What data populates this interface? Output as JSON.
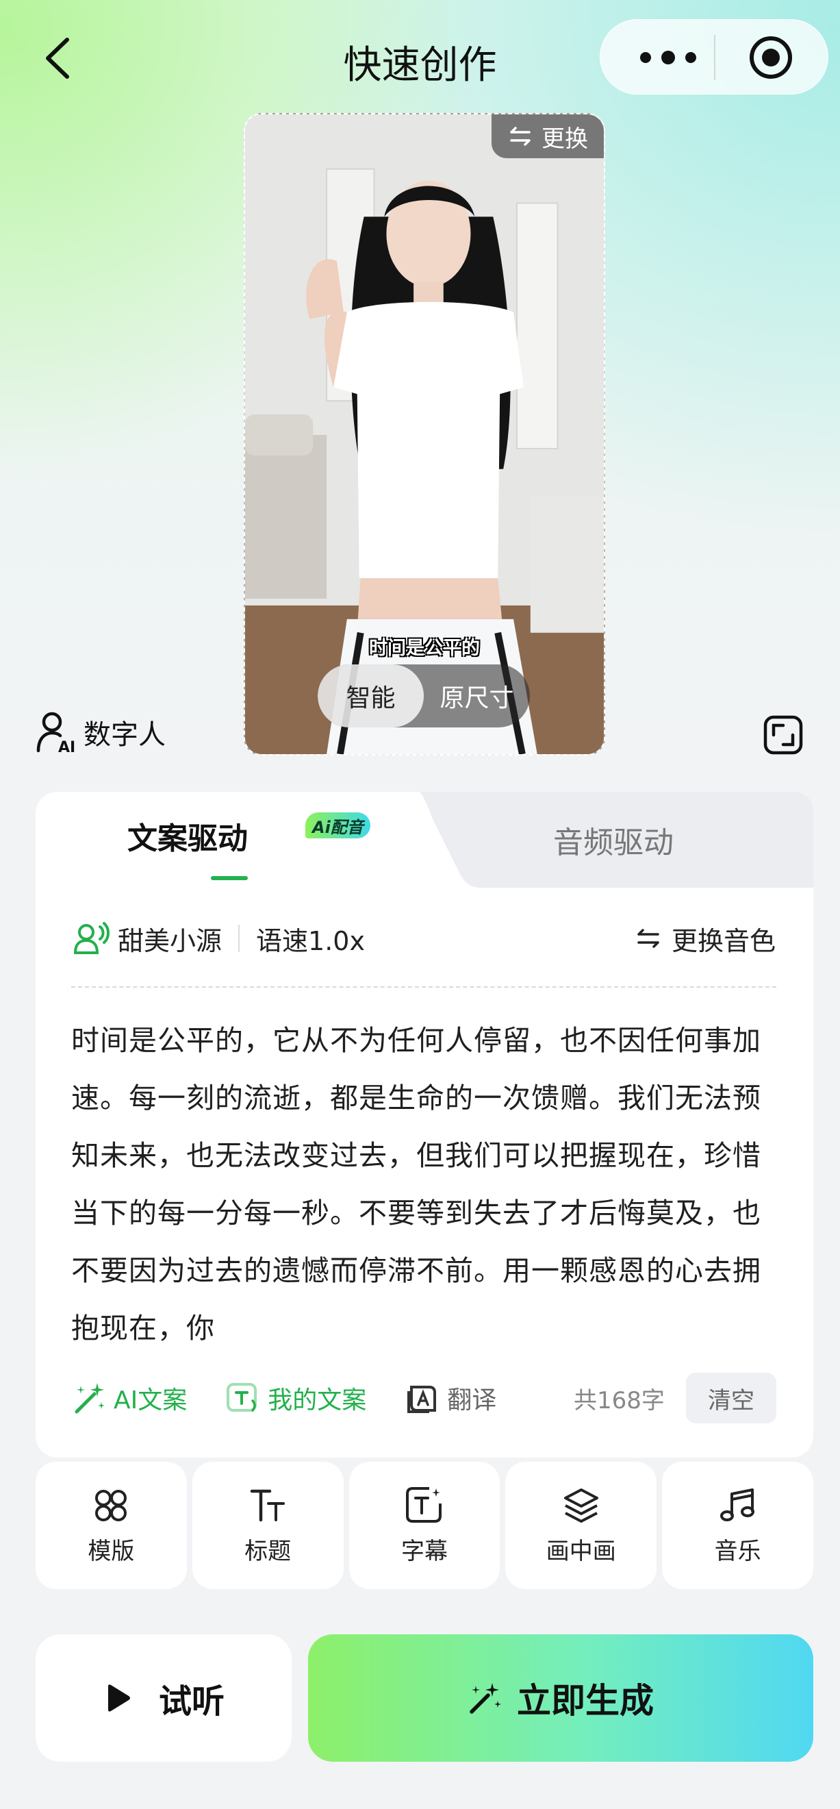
{
  "nav": {
    "title": "快速创作"
  },
  "preview": {
    "change_label": "更换",
    "subtitle": "时间是公平的",
    "size_options": [
      "智能",
      "原尺寸"
    ],
    "active_size": "智能"
  },
  "digital_human": {
    "label": "数字人"
  },
  "tabs": {
    "text_drive": "文案驱动",
    "ai_badge": "Ai配音",
    "audio_drive": "音频驱动"
  },
  "voice": {
    "name": "甜美小源",
    "speed": "语速1.0x",
    "change_label": "更换音色"
  },
  "script_text": "时间是公平的，它从不为任何人停留，也不因任何事加速。每一刻的流逝，都是生命的一次馈赠。我们无法预知未来，也无法改变过去，但我们可以把握现在，珍惜当下的每一分每一秒。不要等到失去了才后悔莫及，也不要因为过去的遗憾而停滞不前。用一颗感恩的心去拥抱现在，你",
  "tools": {
    "ai_copy": "AI文案",
    "my_copy": "我的文案",
    "translate": "翻译",
    "count": "共168字",
    "clear": "清空"
  },
  "features": [
    {
      "label": "模版",
      "icon": "template-icon"
    },
    {
      "label": "标题",
      "icon": "title-icon"
    },
    {
      "label": "字幕",
      "icon": "subtitle-icon"
    },
    {
      "label": "画中画",
      "icon": "layers-icon"
    },
    {
      "label": "音乐",
      "icon": "music-icon"
    }
  ],
  "actions": {
    "listen": "试听",
    "generate": "立即生成"
  },
  "colors": {
    "accent_green": "#23b04c",
    "generate_gradient_start": "#8df06a",
    "generate_gradient_end": "#50d8f2"
  }
}
